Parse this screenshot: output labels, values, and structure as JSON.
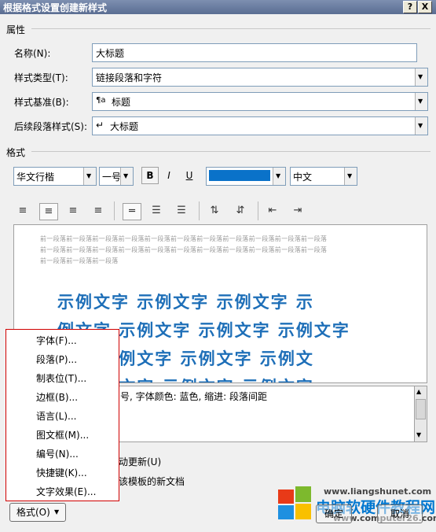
{
  "window": {
    "title": "根据格式设置创建新样式",
    "help_label": "?",
    "close_label": "X"
  },
  "sections": {
    "properties": "属性",
    "format": "格式"
  },
  "properties": {
    "name_label": "名称(N):",
    "name_value": "大标题",
    "style_type_label": "样式类型(T):",
    "style_type_value": "链接段落和字符",
    "based_on_label": "样式基准(B):",
    "based_on_icon": "¶a",
    "based_on_value": "标题",
    "following_label": "后续段落样式(S):",
    "following_icon": "↵",
    "following_value": "大标题"
  },
  "format_toolbar": {
    "font": "华文行楷",
    "size": "一号",
    "bold": "B",
    "italic": "I",
    "underline": "U",
    "color_hex": "#0a72c9",
    "language": "中文"
  },
  "preview": {
    "prev_line_1": "前一段落前一段落前一段落前一段落前一段落前一段落前一段落前一段落前一段落前一段落前一段落",
    "prev_line_2": "前一段落前一段落前一段落前一段落前一段落前一段落前一段落前一段落前一段落前一段落前一段落",
    "prev_line_3": "前一段落前一段落前一段落",
    "sample_line_1": "示例文字 示例文字 示例文字 示",
    "sample_line_2": "例文字 示例文字 示例文字 示例文字",
    "sample_line_3": "文字 示例文字 示例文字 示例文",
    "sample_line_4": "字 示例文字 示例文字 示例文字"
  },
  "description": "号, 字体颜色: 蓝色, 缩进: 段落间距",
  "options": {
    "auto_update": "动更新(U)",
    "template": "该模板的新文档"
  },
  "format_menu": [
    "字体(F)...",
    "段落(P)...",
    "制表位(T)...",
    "边框(B)...",
    "语言(L)...",
    "图文框(M)...",
    "编号(N)...",
    "快捷键(K)...",
    "文字效果(E)..."
  ],
  "buttons": {
    "format": "格式(O)",
    "ok": "确定",
    "cancel": "取消"
  },
  "watermark": {
    "site_cn": "电脑软硬件教程网",
    "url_1": "www.liangshunet.com",
    "url_2": "www.computer26.com"
  }
}
